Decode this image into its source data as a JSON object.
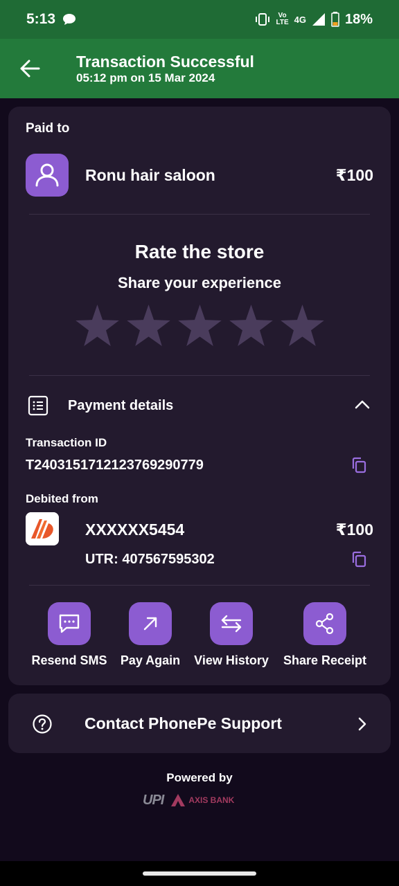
{
  "status_bar": {
    "time": "5:13",
    "volte_top": "Vo",
    "volte_bottom": "LTE",
    "network": "4G",
    "battery": "18%",
    "icons": [
      "chat-icon",
      "vibrate-icon",
      "signal-icon",
      "battery-icon"
    ]
  },
  "header": {
    "title": "Transaction Successful",
    "subtitle": "05:12 pm on 15 Mar 2024",
    "bg_color": "#237a3b"
  },
  "paid_to": {
    "label": "Paid to",
    "merchant_name": "Ronu hair saloon",
    "amount": "₹100"
  },
  "rating": {
    "title": "Rate the store",
    "subtitle": "Share your experience",
    "max_stars": 5,
    "selected_stars": 0
  },
  "payment_details": {
    "title": "Payment details",
    "transaction_id_label": "Transaction ID",
    "transaction_id": "T2403151712123769290779",
    "debited_from_label": "Debited from",
    "account": "XXXXXX5454",
    "amount": "₹100",
    "utr": "UTR: 407567595302"
  },
  "actions": [
    {
      "label": "Resend SMS",
      "icon": "message-icon"
    },
    {
      "label": "Pay Again",
      "icon": "arrow-up-right-icon"
    },
    {
      "label": "View History",
      "icon": "swap-arrows-icon"
    },
    {
      "label": "Share Receipt",
      "icon": "share-icon"
    }
  ],
  "support": {
    "label": "Contact PhonePe Support"
  },
  "footer": {
    "powered_by": "Powered by",
    "partner_1": "UPI",
    "partner_2": "AXIS BANK"
  },
  "colors": {
    "accent": "#8c5cd1",
    "card_bg": "#231a2e",
    "page_bg": "#120a1c",
    "star_inactive": "#4a3c5c"
  }
}
